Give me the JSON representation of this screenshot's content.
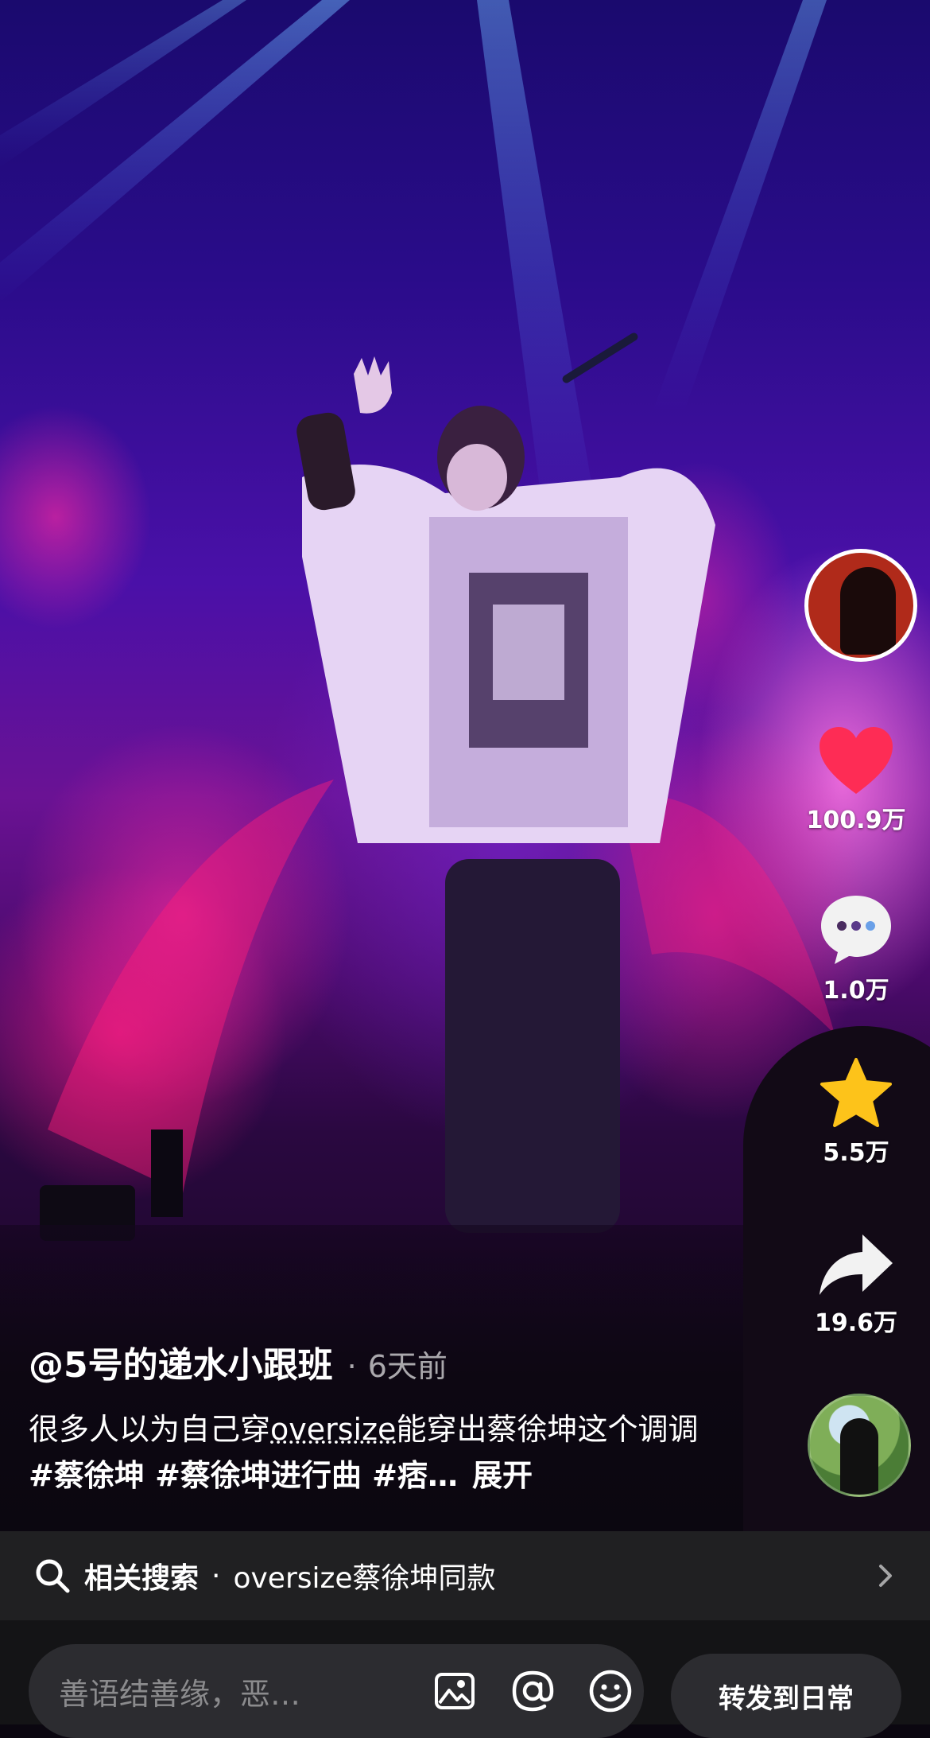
{
  "rail": {
    "like_count": "100.9万",
    "comment_count": "1.0万",
    "favorite_count": "5.5万",
    "share_count": "19.6万"
  },
  "post": {
    "author": "@5号的递水小跟班",
    "separator": "·",
    "time_ago": "6天前",
    "desc_part1": "很多人以为自己穿",
    "desc_keyword": "oversize",
    "desc_part2": "能穿出蔡徐坤这个调调",
    "desc_tags": "#蔡徐坤 #蔡徐坤进行曲 #痞…",
    "expand_label": "展开"
  },
  "related_search": {
    "label": "相关搜索",
    "dot": "·",
    "query": "oversize蔡徐坤同款"
  },
  "bottom_bar": {
    "comment_placeholder": "善语结善缘，恶…",
    "forward_label": "转发到日常"
  },
  "colors": {
    "like": "#fe2c55",
    "favorite": "#fdc31a",
    "bar_bg": "#202022",
    "input_bg": "#2c2c30"
  }
}
